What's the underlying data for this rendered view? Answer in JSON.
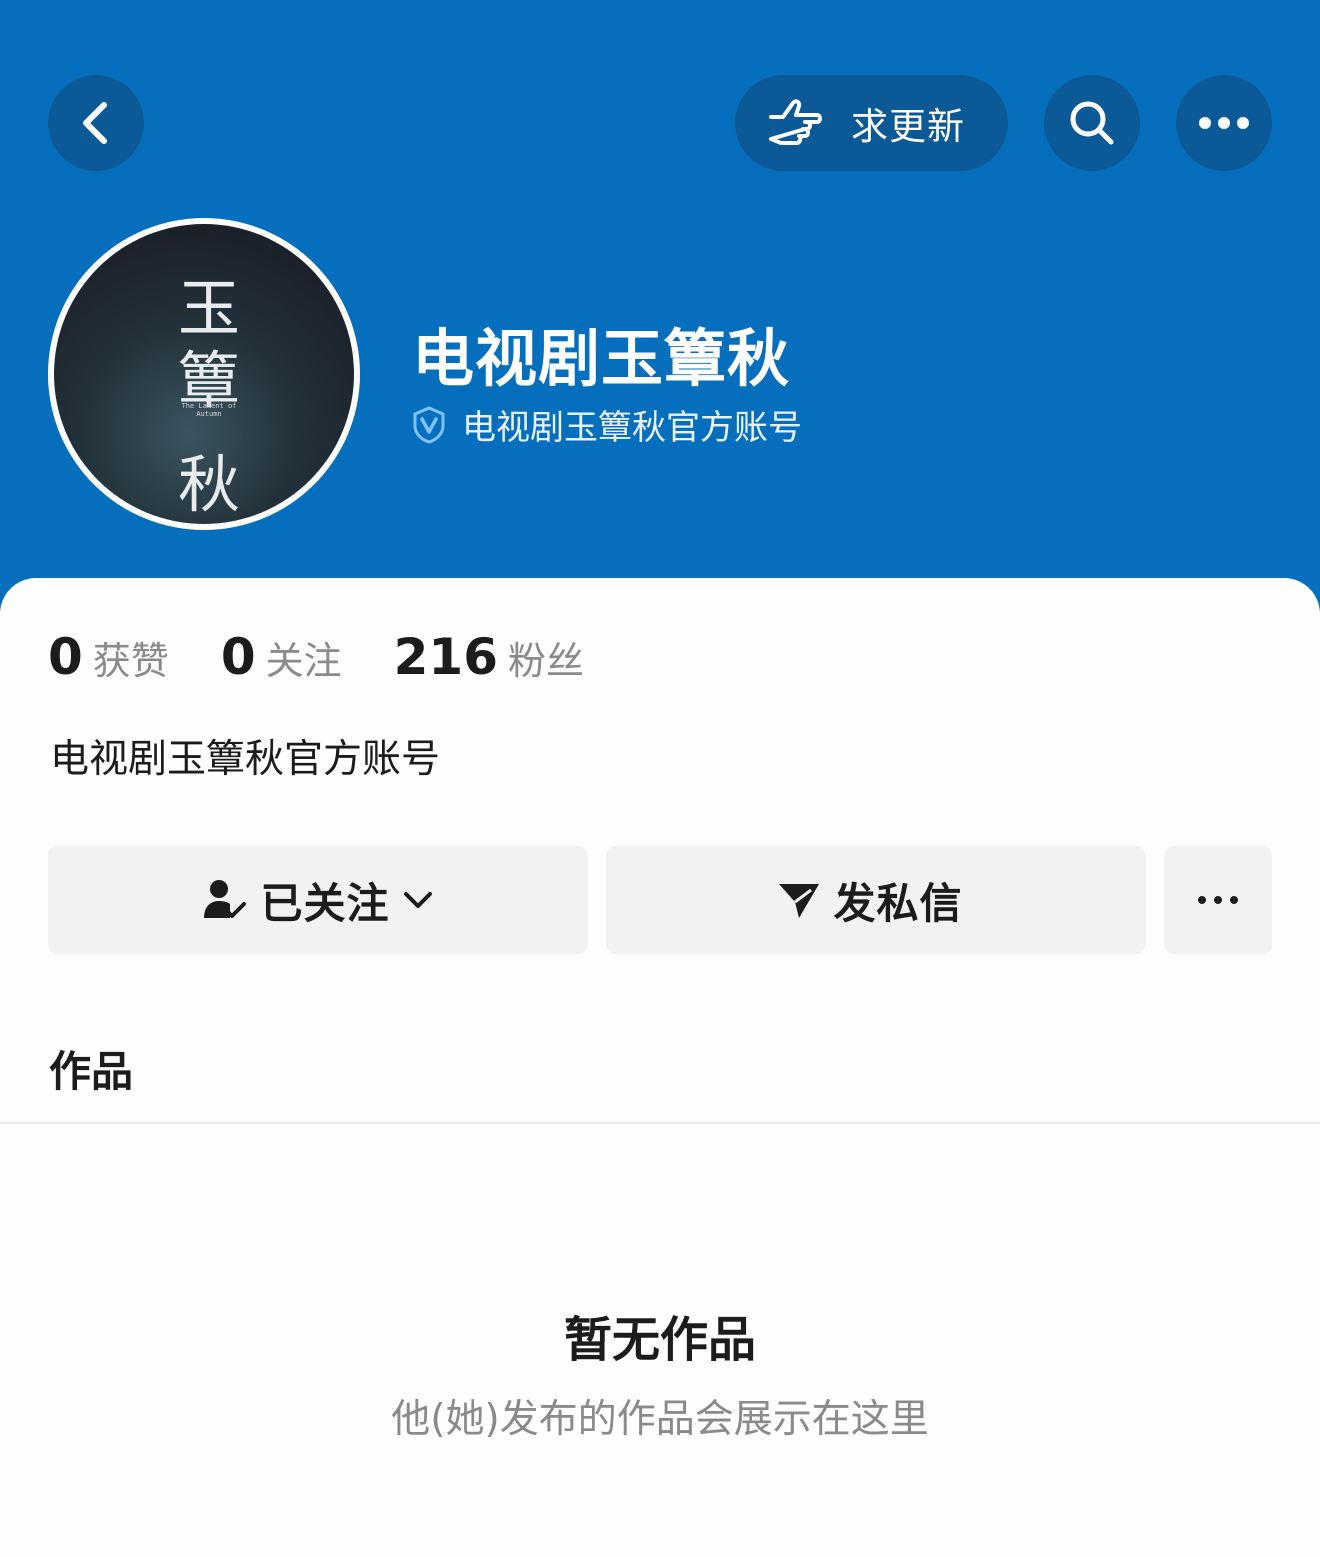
{
  "topbar": {
    "update_request_label": "求更新"
  },
  "profile": {
    "avatar_text": {
      "line1": "玉",
      "line2": "簟",
      "line3": "秋",
      "subtitle": "The Lament of Autumn"
    },
    "name": "电视剧玉簟秋",
    "verification": "电视剧玉簟秋官方账号"
  },
  "stats": [
    {
      "value": "0",
      "label": "获赞"
    },
    {
      "value": "0",
      "label": "关注"
    },
    {
      "value": "216",
      "label": "粉丝"
    }
  ],
  "bio": "电视剧玉簟秋官方账号",
  "actions": {
    "follow_label": "已关注",
    "message_label": "发私信"
  },
  "tabs": {
    "works_label": "作品"
  },
  "empty_state": {
    "title": "暂无作品",
    "subtitle": "他(她)发布的作品会展示在这里"
  },
  "colors": {
    "header_bg": "#066fbd",
    "header_button_bg": "#0b5a97",
    "verify_icon": "#7fc4ff"
  },
  "icons": {
    "back": "chevron-left-icon",
    "update_request": "pointing-hand-icon",
    "search": "search-icon",
    "more": "more-dots-icon",
    "verified": "verified-v-icon",
    "follow": "user-check-icon",
    "follow_dropdown": "chevron-down-icon",
    "message": "send-icon",
    "extra": "more-dots-icon"
  }
}
